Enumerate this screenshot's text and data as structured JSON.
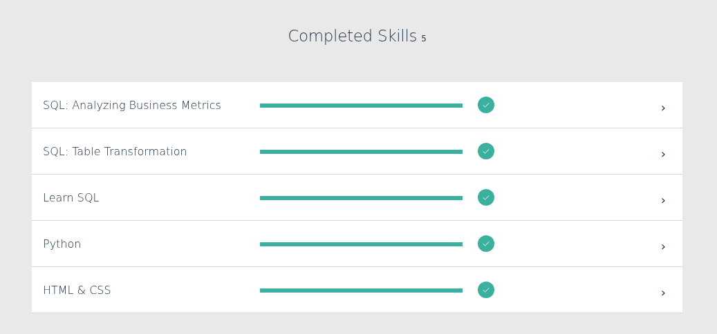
{
  "heading": {
    "title": "Completed Skills",
    "count": "5"
  },
  "skills": [
    {
      "name": "SQL: Analyzing Business Metrics",
      "level": 1,
      "completed": true,
      "chevron": "›"
    },
    {
      "name": "SQL: Table Transformation",
      "level": 1,
      "completed": true,
      "chevron": "›"
    },
    {
      "name": "Learn SQL",
      "level": 1,
      "completed": true,
      "chevron": "›"
    },
    {
      "name": "Python",
      "level": 1,
      "completed": true,
      "chevron": "›"
    },
    {
      "name": "HTML & CSS",
      "level": 1,
      "completed": true,
      "chevron": "›"
    }
  ]
}
